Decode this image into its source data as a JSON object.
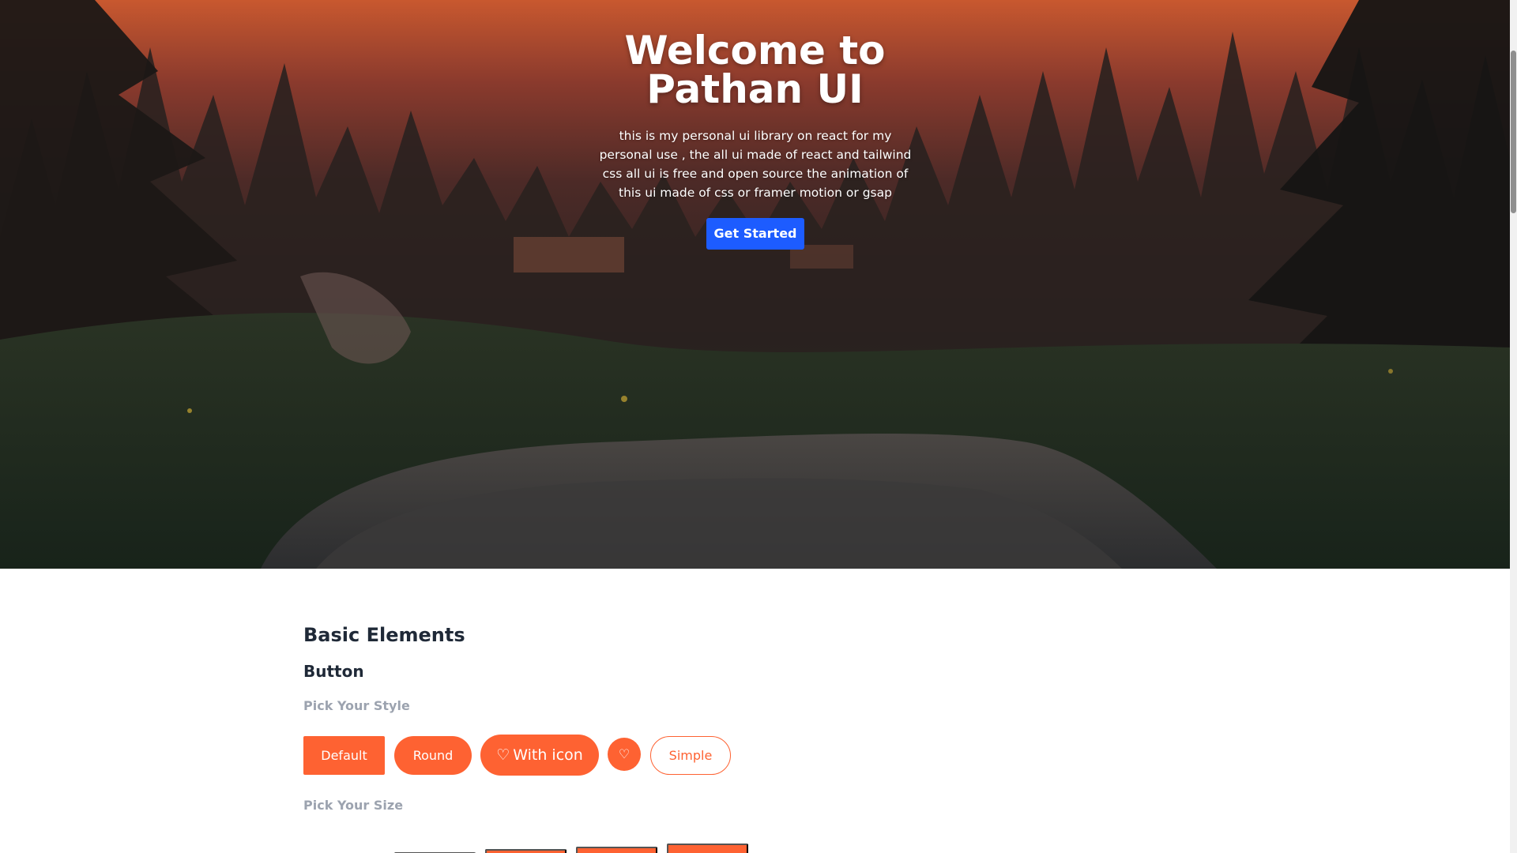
{
  "hero": {
    "title_line1": "Welcome to",
    "title_line2": "Pathan UI",
    "description": "this is my personal ui library on react for my personal use , the all ui made of react and tailwind css all ui is free and open source the animation of this ui made of css or framer motion or gsap",
    "cta_label": "Get Started",
    "background": "forest-landscape-image"
  },
  "content": {
    "section_title": "Basic Elements",
    "subsection_title": "Button",
    "pick_style_label": "Pick Your Style",
    "pick_size_label": "Pick Your Size",
    "style_buttons": {
      "default": "Default",
      "round": "Round",
      "with_icon": "With icon",
      "icon_only": "",
      "simple": "Simple"
    },
    "icon": "heart-icon"
  },
  "colors": {
    "accent": "#fe6232",
    "cta": "#1d5cff",
    "muted_label": "#9ca3af",
    "heading": "#1f2937"
  }
}
